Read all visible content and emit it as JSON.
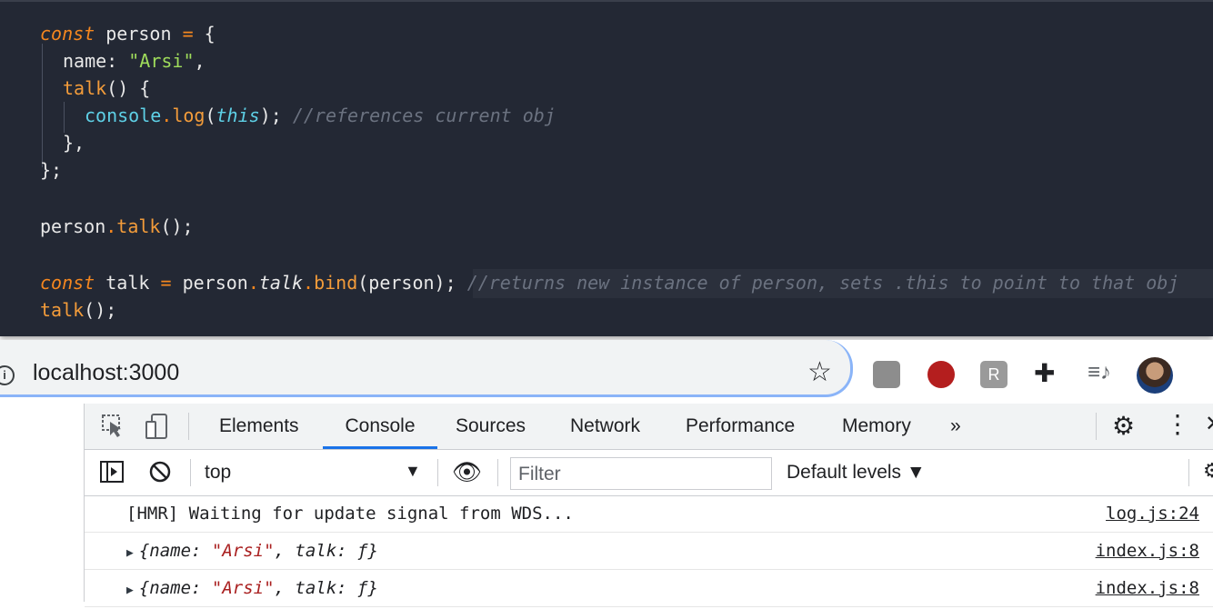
{
  "editor": {
    "lines": {
      "l1": {
        "kw": "const",
        "name": "person",
        "op": "=",
        "brace": "{"
      },
      "l2": {
        "key": "name:",
        "value": "\"Arsi\"",
        "comma": ","
      },
      "l3": {
        "fn": "talk",
        "rest": "() {"
      },
      "l4": {
        "obj": "console",
        "dot": ".",
        "fn": "log",
        "open": "(",
        "this": "this",
        "close": ");",
        "comment": "//references current obj"
      },
      "l5": {
        "text": "},"
      },
      "l6": {
        "text": "};"
      },
      "l8": {
        "obj": "person",
        "dot": ".",
        "fn": "talk",
        "rest": "();"
      },
      "l10": {
        "kw": "const",
        "name": "talk",
        "op": "=",
        "obj": "person",
        "dot": ".",
        "prop": "talk",
        "dot2": ".",
        "fn": "bind",
        "rest": "(person);",
        "comment": "//returns new instance of person, sets .this to point to that obj"
      },
      "l11": {
        "fn": "talk",
        "rest": "();"
      }
    }
  },
  "browser": {
    "url": "localhost:3000",
    "ext3_label": "R"
  },
  "devtools": {
    "tabs": [
      "Elements",
      "Console",
      "Sources",
      "Network",
      "Performance",
      "Memory",
      "»"
    ],
    "active_tab": "Console",
    "context": "top",
    "filter_placeholder": "Filter",
    "levels": "Default levels ▼",
    "logs": [
      {
        "message": "[HMR] Waiting for update signal from WDS...",
        "source": "log.js:24"
      },
      {
        "prefix": "{name: ",
        "value": "\"Arsi\"",
        "suffix": ", talk: ƒ}",
        "source": "index.js:8"
      },
      {
        "prefix": "{name: ",
        "value": "\"Arsi\"",
        "suffix": ", talk: ƒ}",
        "source": "index.js:8"
      }
    ]
  }
}
